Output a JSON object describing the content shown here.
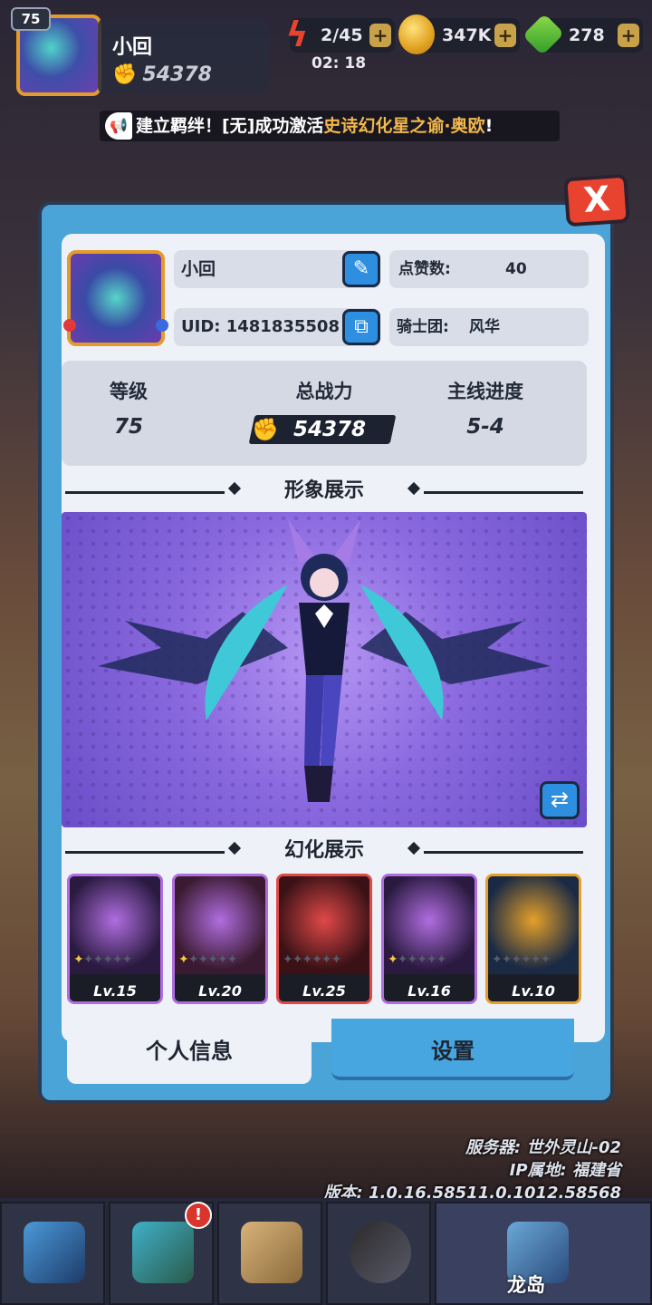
{
  "hud": {
    "level": "75",
    "name": "小回",
    "power": "54378",
    "energy": "2/45",
    "gold": "347K",
    "gems": "278",
    "timer": "02: 18",
    "plus": "+"
  },
  "broadcast": {
    "prefix": "建立羁绊！[无]成功激活",
    "highlight": "史诗幻化星之谕·奥欧",
    "suffix": "!"
  },
  "profile": {
    "close": "X",
    "name": "小回",
    "uid": "UID: 1481835508",
    "likes_label": "点赞数:",
    "likes_value": "40",
    "guild_label": "骑士团:",
    "guild_value": "风华"
  },
  "stats": {
    "level_label": "等级",
    "level_value": "75",
    "power_label": "总战力",
    "power_value": "54378",
    "progress_label": "主线进度",
    "progress_value": "5-4"
  },
  "sections": {
    "appearance": "形象展示",
    "transform": "幻化展示"
  },
  "cards": [
    {
      "level": "Lv.15",
      "stars": 1,
      "border": "#b06de0",
      "art": "#2a1a40"
    },
    {
      "level": "Lv.20",
      "stars": 1,
      "border": "#b06de0",
      "art": "#3a1a30"
    },
    {
      "level": "Lv.25",
      "stars": 0,
      "border": "#e04848",
      "art": "#3a1216"
    },
    {
      "level": "Lv.16",
      "stars": 1,
      "border": "#b06de0",
      "art": "#2a1a40"
    },
    {
      "level": "Lv.10",
      "stars": 0,
      "border": "#e5a02a",
      "art": "#1a2a44"
    }
  ],
  "tabs": {
    "personal": "个人信息",
    "settings": "设置"
  },
  "server": {
    "server": "服务器: 世外灵山-02",
    "ip": "IP属地: 福建省",
    "version": "版本: 1.0.16.58511.0.1012.58568"
  },
  "nav": {
    "badge": "!",
    "dragon_island": "龙岛"
  },
  "colors": {
    "panel_blue": "#4aa4d8",
    "close_red": "#e8432e",
    "gold_highlight": "#f3b74b"
  }
}
